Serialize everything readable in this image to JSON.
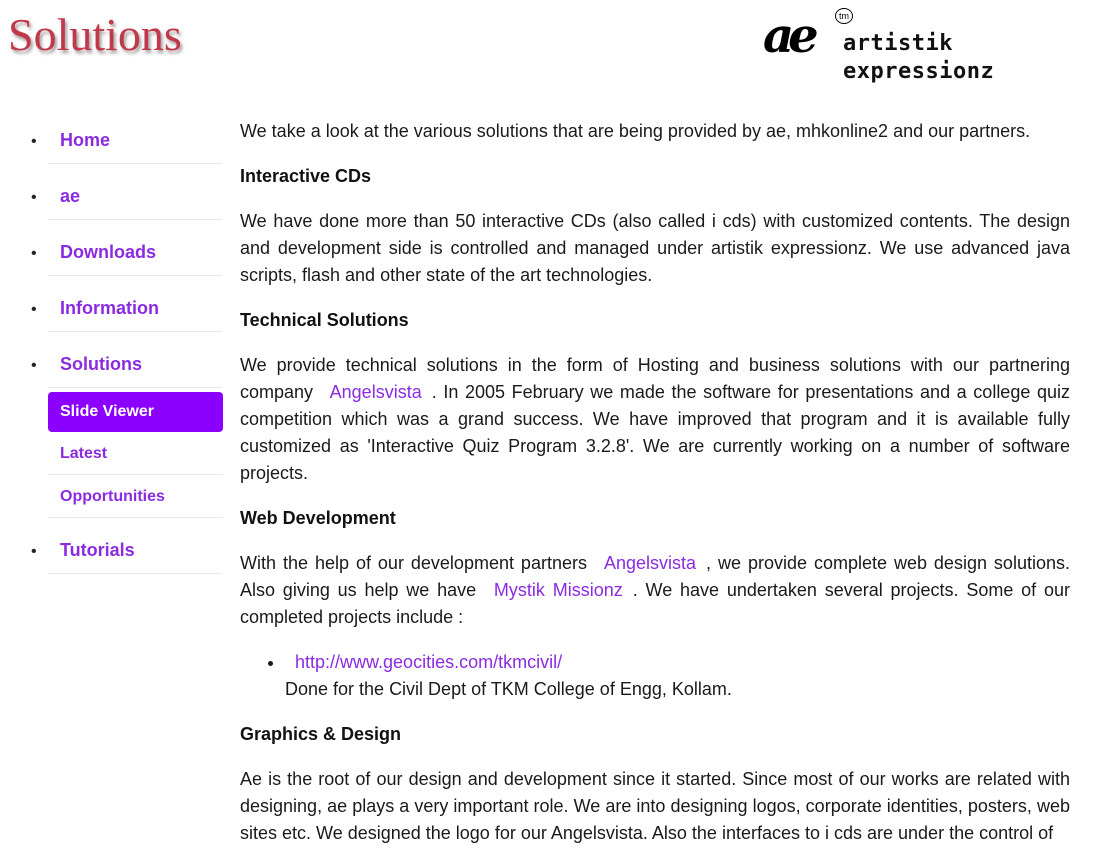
{
  "header": {
    "title": "Solutions",
    "logo": {
      "mark": "ae",
      "tm": "tm",
      "text": "artistik expressionz"
    }
  },
  "sidebar": {
    "items": [
      {
        "label": "Home"
      },
      {
        "label": "ae"
      },
      {
        "label": "Downloads"
      },
      {
        "label": "Information"
      },
      {
        "label": "Solutions"
      },
      {
        "label": "Tutorials"
      }
    ],
    "subitems": [
      {
        "label": "Slide Viewer",
        "active": true
      },
      {
        "label": "Latest"
      },
      {
        "label": "Opportunities"
      }
    ]
  },
  "content": {
    "intro": "We take a look at the various solutions that are being provided by ae, mhkonline2 and our partners.",
    "cds_heading": "Interactive CDs",
    "cds_text": "We have done more than 50 interactive CDs (also called i cds) with customized contents.  The design and development side is controlled and managed under artistik expressionz. We use advanced java scripts, flash and other state of the art technologies.",
    "tech_heading": "Technical Solutions",
    "tech_text_1": "We provide technical solutions in the form of Hosting and business solutions with our partnering company",
    "tech_link": "Angelsvista",
    "tech_text_2": ". In 2005 February we made the software for presentations and a college quiz competition which was a grand success. We have improved that program and it is available fully customized as 'Interactive Quiz Program 3.2.8'. We are currently working on a number of software projects.",
    "web_heading": "Web Development",
    "web_text_1": "With the help of our development partners",
    "web_link_1": "Angelsvista",
    "web_text_2": ", we provide complete web design solutions. Also giving us help we have",
    "web_link_2": "Mystik Missionz",
    "web_text_3": ". We have undertaken several projects. Some of our completed projects include :",
    "projects": [
      {
        "url": "http://www.geocities.com/tkmcivil/",
        "desc": "Done for the Civil Dept of TKM College of Engg, Kollam."
      }
    ],
    "graphics_heading": "Graphics & Design",
    "graphics_text": "Ae is the root of our design and development since it started.  Since most of our works are related with designing, ae plays a very important role. We are into designing logos, corporate identities, posters, web sites etc. We designed the logo for our Angelsvista. Also the interfaces to i cds are under the control of"
  },
  "colors": {
    "link": "#8a2be2",
    "active_bg": "#8b00ff",
    "title": "#c0394b"
  }
}
